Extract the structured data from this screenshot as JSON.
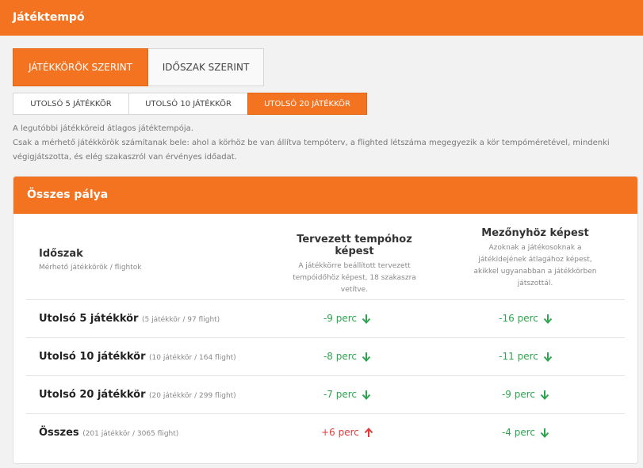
{
  "header": {
    "title": "Játéktempó"
  },
  "mode_tabs": [
    {
      "label": "JÁTÉKKÖRÖK SZERINT",
      "active": true
    },
    {
      "label": "IDŐSZAK SZERINT",
      "active": false
    }
  ],
  "range_tabs": [
    {
      "label": "UTOLSÓ 5 JÁTÉKKÖR",
      "active": false
    },
    {
      "label": "UTOLSÓ 10 JÁTÉKKÖR",
      "active": false
    },
    {
      "label": "UTOLSÓ 20 JÁTÉKKÖR",
      "active": true
    }
  ],
  "description": {
    "line1": "A legutóbbi játékköreid átlagos játéktempója.",
    "line2": "Csak a mérhető játékkörök számítanak bele: ahol a körhöz be van állítva tempóterv, a flighted létszáma megegyezik a kör tempóméretével, mindenki végigjátszotta, és elég szakaszról van érvényes időadat."
  },
  "card": {
    "title": "Összes pálya",
    "col_period": {
      "title": "Időszak",
      "subtitle": "Mérhető játékkörök / flightok"
    },
    "col_planned": {
      "title": "Tervezett tempóhoz képest",
      "subtitle": "A játékkörre beállított tervezett tempóidőhöz képest, 18 szakaszra vetítve."
    },
    "col_field": {
      "title": "Mezőnyhöz képest",
      "subtitle": "Azoknak a játékosoknak a játékidejének átlagához képest, akikkel ugyanabban a játékkörben játszottál."
    },
    "rows": [
      {
        "label": "Utolsó 5 játékkör",
        "sub": "(5 játékkör / 97 flight)",
        "planned": "-9 perc",
        "planned_dir": "down",
        "field": "-16 perc",
        "field_dir": "down"
      },
      {
        "label": "Utolsó 10 játékkör",
        "sub": "(10 játékkör / 164 flight)",
        "planned": "-8 perc",
        "planned_dir": "down",
        "field": "-11 perc",
        "field_dir": "down"
      },
      {
        "label": "Utolsó 20 játékkör",
        "sub": "(20 játékkör / 299 flight)",
        "planned": "-7 perc",
        "planned_dir": "down",
        "field": "-9 perc",
        "field_dir": "down"
      },
      {
        "label": "Összes",
        "sub": "(201 játékkör / 3065 flight)",
        "planned": "+6 perc",
        "planned_dir": "up",
        "field": "-4 perc",
        "field_dir": "down"
      }
    ]
  },
  "colors": {
    "accent": "#f47320",
    "good": "#2ea44f",
    "bad": "#e03b3b"
  },
  "icons": {
    "down": "arrow-down-icon",
    "up": "arrow-up-icon"
  }
}
